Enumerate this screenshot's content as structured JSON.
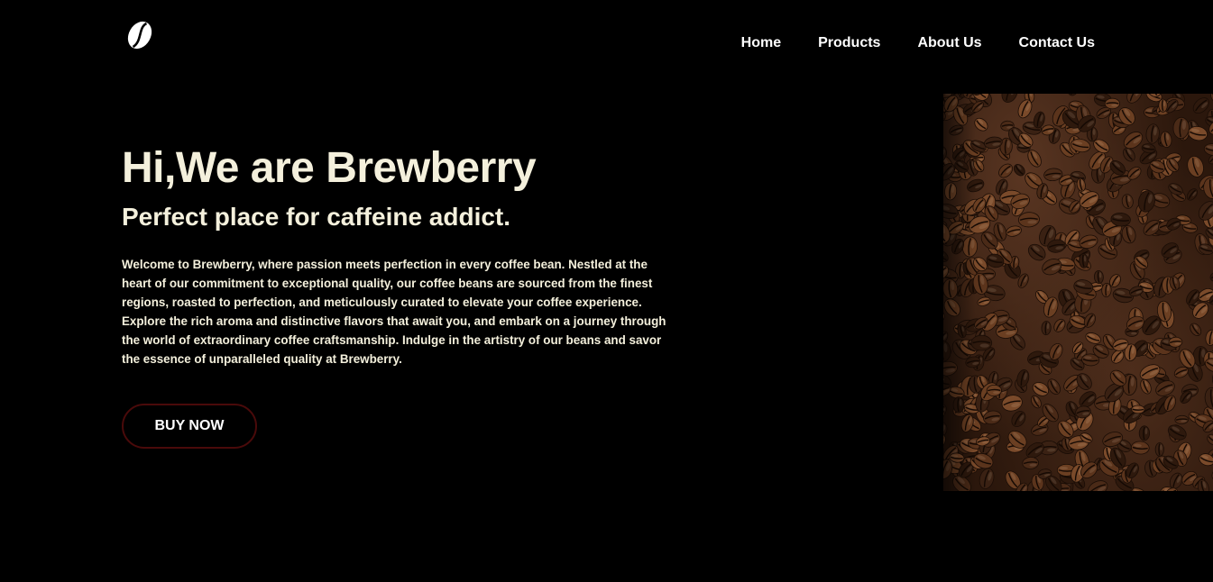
{
  "header": {
    "logo_icon": "coffee-bean-icon",
    "nav": [
      {
        "label": "Home"
      },
      {
        "label": "Products"
      },
      {
        "label": "About Us"
      },
      {
        "label": "Contact Us"
      }
    ]
  },
  "hero": {
    "title": "Hi,We are Brewberry",
    "subtitle": "Perfect place for caffeine addict.",
    "description": "Welcome to Brewberry, where passion meets perfection in every coffee bean. Nestled at the heart of our commitment to exceptional quality, our coffee beans are sourced from the finest regions, roasted to perfection, and meticulously curated to elevate your coffee experience. Explore the rich aroma and distinctive flavors that await you, and embark on a journey through the world of extraordinary coffee craftsmanship. Indulge in the artistry of our beans and savor the essence of unparalleled quality at Brewberry.",
    "button_label": "BUY NOW",
    "image_icon": "coffee-beans-image"
  },
  "colors": {
    "background": "#000000",
    "text_cream": "#f4f0dc",
    "nav_text": "#ffffff",
    "button_border": "#4a0a0a",
    "bean_dark": "#2b170c",
    "bean_mid": "#4d2d1b"
  }
}
